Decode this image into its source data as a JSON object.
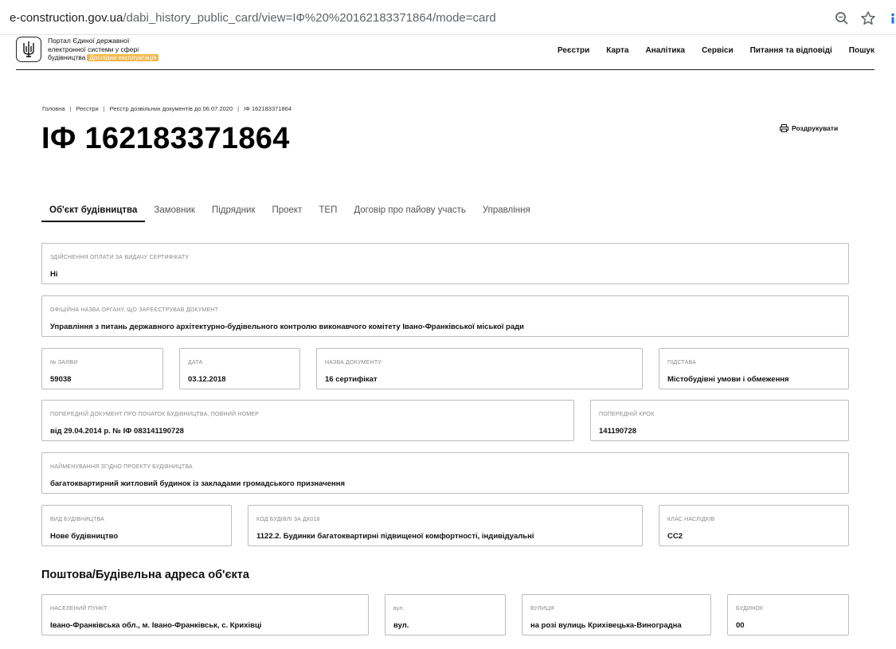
{
  "browser": {
    "url_host": "e-construction.gov.ua",
    "url_path": "/dabi_history_public_card/view=ІФ%20%20162183371864/mode=card"
  },
  "header": {
    "logo_line1": "Портал Єдиної державної",
    "logo_line2": "електронної системи у сфері",
    "logo_line3": "будівництва",
    "beta_badge": "Дослідна експлуатація",
    "nav": [
      "Реєстри",
      "Карта",
      "Аналітика",
      "Сервіси",
      "Питання та відповіді",
      "Пошук"
    ]
  },
  "breadcrumb": [
    "Головна",
    "Реєстри",
    "Реєстр дозвільних документів до 06.07.2020",
    "ІФ 162183371864"
  ],
  "page": {
    "title": "ІФ 162183371864",
    "print_label": "Роздрукувати"
  },
  "tabs": [
    "Об'єкт будівництва",
    "Замовник",
    "Підрядник",
    "Проект",
    "ТЕП",
    "Договір про пайову участь",
    "Управління"
  ],
  "fields": {
    "payment": {
      "label": "Здійснення оплати за видачу сертифікату",
      "value": "Ні"
    },
    "authority": {
      "label": "Офіційна назва органу, що зареєстрував документ",
      "value": "Управління з питань державного архітектурно-будівельного контролю виконавчого комітету Івано-Франківської міської ради"
    },
    "app_number": {
      "label": "№ заяви",
      "value": "59038"
    },
    "date": {
      "label": "Дата",
      "value": "03.12.2018"
    },
    "doc_name": {
      "label": "Назва документу",
      "value": "16 сертифікат"
    },
    "basis": {
      "label": "Підстава",
      "value": "Містобудівні умови і обмеження"
    },
    "prev_doc": {
      "label": "Попередній документ про початок будівництва, повний номер",
      "value": "від 29.04.2014 р. № ІФ 083141190728"
    },
    "prev_step": {
      "label": "Попередній крок",
      "value": "141190728"
    },
    "project_name": {
      "label": "Найменування згідно проекту будівництва",
      "value": "багатоквартирний житловий будинок із закладами громадського призначення"
    },
    "construction_type": {
      "label": "Вид будівництва",
      "value": "Нове будівництво"
    },
    "building_code": {
      "label": "Код будівлі за ДК018",
      "value": "1122.2. Будинки багатоквартирні підвищеної комфортності, індивідуальні"
    },
    "consequence_class": {
      "label": "Клас наслідків",
      "value": "СС2"
    }
  },
  "address": {
    "heading": "Поштова/Будівельна адреса об'єкта",
    "settlement": {
      "label": "Населений пункт",
      "value": "Івано-Франківська обл., м. Івано-Франківськ, с. Крихівці"
    },
    "street_type": {
      "label": "вул.",
      "value": "вул."
    },
    "street": {
      "label": "Вулиця",
      "value": "на розі вулиць Крихівецька-Виноградна"
    },
    "building": {
      "label": "Будинок",
      "value": "00"
    }
  }
}
